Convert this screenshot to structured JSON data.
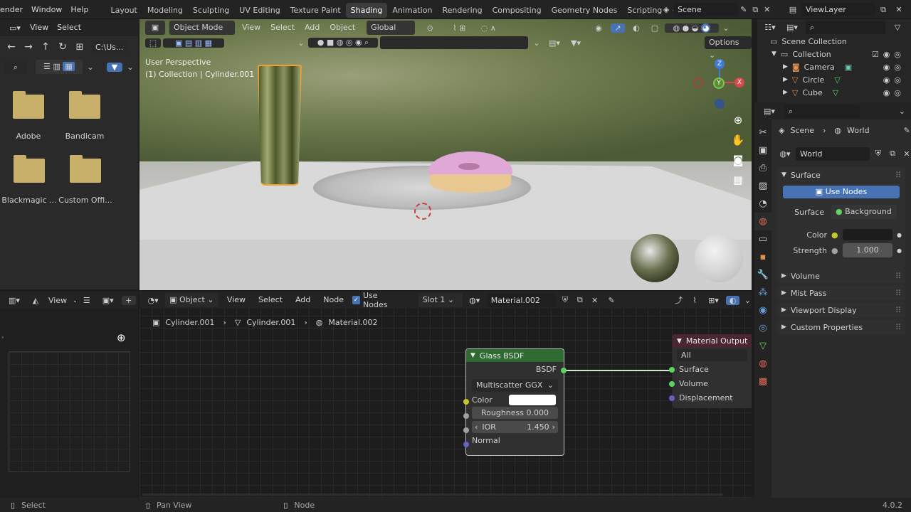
{
  "topbar": {
    "menus": [
      "ender",
      "Window",
      "Help"
    ],
    "workspaces": [
      "Layout",
      "Modeling",
      "Sculpting",
      "UV Editing",
      "Texture Paint",
      "Shading",
      "Animation",
      "Rendering",
      "Compositing",
      "Geometry Nodes",
      "Scripting"
    ],
    "active_workspace": "Shading",
    "add_tab": "+",
    "scene_label": "Scene",
    "viewlayer_label": "ViewLayer"
  },
  "filebrowser": {
    "menus": [
      "View",
      "Select"
    ],
    "path": "C:\\Us...",
    "folders": [
      "Adobe",
      "Bandicam",
      "Blackmagic ...",
      "Custom Offi..."
    ]
  },
  "viewport": {
    "mode": "Object Mode",
    "menus": [
      "View",
      "Select",
      "Add",
      "Object"
    ],
    "orientation": "Global",
    "options_label": "Options",
    "info_line1": "User Perspective",
    "info_line2": "(1) Collection | Cylinder.001",
    "gizmo_x": "X",
    "gizmo_y": "Y",
    "gizmo_z": "Z"
  },
  "outliner": {
    "root": "Scene Collection",
    "collection": "Collection",
    "items": [
      "Camera",
      "Circle",
      "Cube"
    ]
  },
  "properties": {
    "breadcrumb_scene": "Scene",
    "breadcrumb_world": "World",
    "world_name": "World",
    "surface_section": "Surface",
    "use_nodes_button": "Use Nodes",
    "surface_label": "Surface",
    "surface_value": "Background",
    "color_label": "Color",
    "strength_label": "Strength",
    "strength_value": "1.000",
    "sections": [
      "Volume",
      "Mist Pass",
      "Viewport Display",
      "Custom Properties"
    ]
  },
  "image_editor": {
    "view_label": "View"
  },
  "node_editor": {
    "object_dropdown": "Object",
    "menus": [
      "View",
      "Select",
      "Add",
      "Node"
    ],
    "use_nodes_label": "Use Nodes",
    "slot": "Slot 1",
    "material": "Material.002",
    "breadcrumbs": [
      "Cylinder.001",
      "Cylinder.001",
      "Material.002"
    ],
    "glass_node": {
      "title": "Glass BSDF",
      "output": "BSDF",
      "distribution": "Multiscatter GGX",
      "color_label": "Color",
      "roughness_label": "Roughness",
      "roughness_value": "0.000",
      "ior_label": "IOR",
      "ior_value": "1.450",
      "normal_label": "Normal"
    },
    "output_node": {
      "title": "Material Output",
      "target": "All",
      "inputs": [
        "Surface",
        "Volume",
        "Displacement"
      ]
    }
  },
  "statusbar": {
    "select": "Select",
    "pan": "Pan View",
    "node": "Node",
    "version": "4.0.2"
  },
  "colors": {
    "accent_blue": "#4772b3",
    "glass_header": "#2e6b33",
    "output_header": "#4a2630",
    "selection_orange": "#f0a030",
    "socket_yellow": "#c7c729",
    "socket_green": "#5fd35f",
    "socket_purple": "#6363c7",
    "socket_grey": "#a1a1a1"
  }
}
